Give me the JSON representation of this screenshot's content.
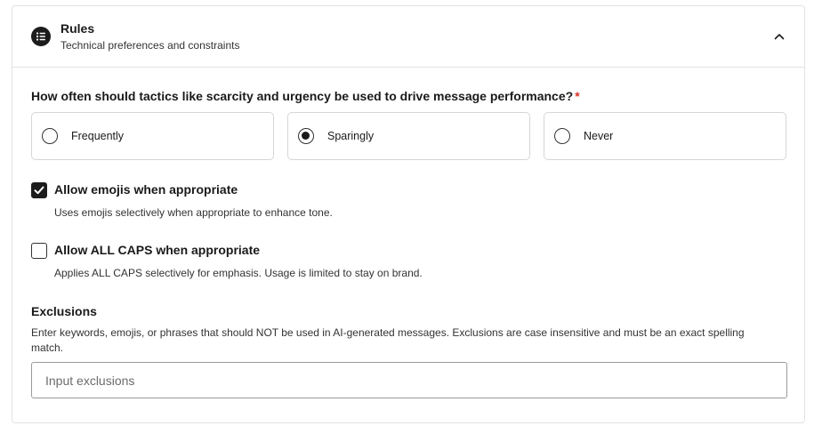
{
  "header": {
    "title": "Rules",
    "subtitle": "Technical preferences and constraints",
    "icon": "list-icon",
    "collapse_icon": "chevron-up-icon"
  },
  "question": {
    "text": "How often should tactics like scarcity and urgency be used to drive message performance?",
    "required_marker": "*",
    "options": [
      {
        "label": "Frequently",
        "selected": false
      },
      {
        "label": "Sparingly",
        "selected": true
      },
      {
        "label": "Never",
        "selected": false
      }
    ]
  },
  "checkboxes": [
    {
      "label": "Allow emojis when appropriate",
      "description": "Uses emojis selectively when appropriate to enhance tone.",
      "checked": true
    },
    {
      "label": "Allow ALL CAPS when appropriate",
      "description": "Applies ALL CAPS selectively for emphasis. Usage is limited to stay on brand.",
      "checked": false
    }
  ],
  "exclusions": {
    "title": "Exclusions",
    "description": "Enter keywords, emojis, or phrases that should NOT be used in AI-generated messages. Exclusions are case insensitive and must be an exact spelling match.",
    "placeholder": "Input exclusions",
    "value": ""
  },
  "colors": {
    "required": "#d93025",
    "border": "#e3e3e3",
    "checked": "#1c1c1c"
  }
}
